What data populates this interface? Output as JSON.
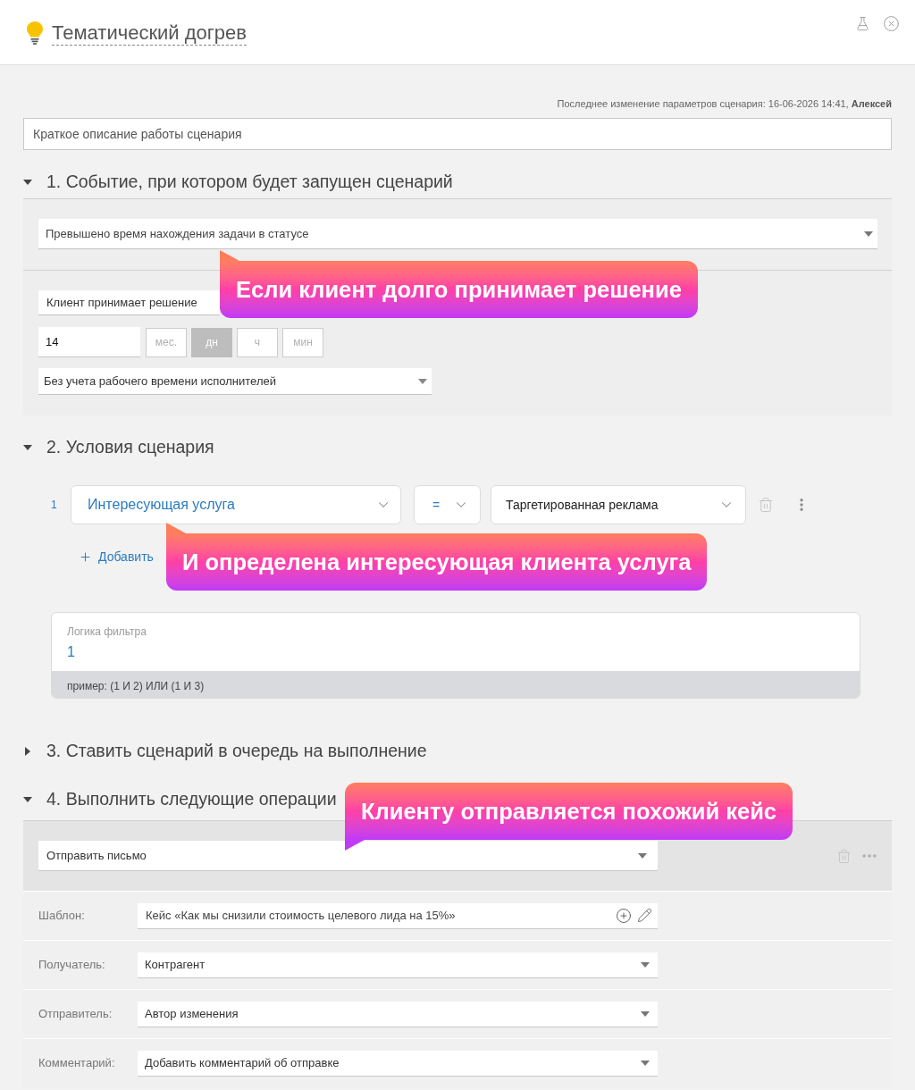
{
  "header": {
    "title": "Тематический догрев"
  },
  "last_modified": "Последнее изменение параметров сценария: 16-06-2026 14:41, **Алексей**",
  "description": {
    "placeholder": "Краткое описание работы сценария"
  },
  "sections": [
    {
      "kind": "event",
      "title": "1. Событие, при котором будет запущен сценарий",
      "expanded": true,
      "event_select": "Превышено время нахождения задачи в статусе",
      "status_select": "Клиент принимает решение",
      "duration": "14",
      "units": [
        {
          "label": "мес.",
          "selected": false
        },
        {
          "label": "дн",
          "selected": true
        },
        {
          "label": "ч",
          "selected": false
        },
        {
          "label": "мин",
          "selected": false
        }
      ],
      "schedule_select": "Без учета рабочего времени исполнителей",
      "callout": {
        "kind": "up",
        "text": "Если клиент долго принимает решение"
      }
    },
    {
      "kind": "conditions",
      "title": "2. Условия сценария",
      "expanded": true,
      "conditions": [
        {
          "number": "1",
          "field": "Интересующая услуга",
          "operator": "=",
          "value": "Таргетированная реклама"
        }
      ],
      "add_button": "Добавить",
      "filter_logic": {
        "label": "Логика фильтра",
        "value": "1",
        "hint": "пример: (1 И 2) ИЛИ (1 И 3)"
      },
      "callout": {
        "kind": "up",
        "text": "И определена интересующая клиента услуга"
      }
    },
    {
      "kind": "queue",
      "title": "3. Ставить сценарий в очередь на выполнение",
      "expanded": false
    },
    {
      "kind": "operations",
      "title": "4. Выполнить следующие операции",
      "expanded": true,
      "operation_select": "Отправить письмо",
      "fields": [
        {
          "kind": "template",
          "label": "Шаблон:",
          "value": "Кейс «Как мы снизили стоимость целевого лида на 15%»"
        },
        {
          "kind": "select",
          "label": "Получатель:",
          "value": "Контрагент"
        },
        {
          "kind": "select",
          "label": "Отправитель:",
          "value": "Автор изменения"
        },
        {
          "kind": "select",
          "label": "Комментарий:",
          "value": "Добавить комментарий об отправке"
        }
      ],
      "callout": {
        "kind": "down",
        "text": "Клиенту отправляется похожий кейс"
      }
    }
  ]
}
